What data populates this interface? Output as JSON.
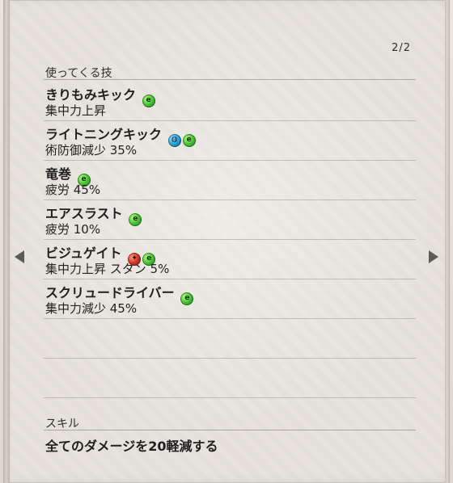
{
  "page_indicator": "2/2",
  "moves_section_title": "使ってくる技",
  "moves": [
    {
      "name": "きりもみキック",
      "effect": "集中力上昇",
      "icons": [
        "green-e-icon"
      ]
    },
    {
      "name": "ライトニングキック",
      "effect": "術防御減少 35%",
      "icons": [
        "blue-water-icon",
        "green-e-icon"
      ]
    },
    {
      "name": "竜巻",
      "effect": "疲労 45%",
      "icons": [
        "green-e-icon"
      ]
    },
    {
      "name": "エアスラスト",
      "effect": "疲労 10%",
      "icons": [
        "green-e-icon"
      ]
    },
    {
      "name": "ビジュゲイト",
      "effect": "集中力上昇 スタン 5%",
      "icons": [
        "red-fire-icon",
        "green-e-icon"
      ]
    },
    {
      "name": "スクリュードライバー",
      "effect": "集中力減少 45%",
      "icons": [
        "green-e-icon"
      ]
    }
  ],
  "skill_section_title": "スキル",
  "skill_text": "全てのダメージを20軽減する",
  "colors": {
    "green_icon": "#49c53a",
    "blue_icon": "#2ca6d9",
    "red_icon": "#d63a2b",
    "text": "#1f1f1f",
    "arrow": "#5b5b5b"
  }
}
